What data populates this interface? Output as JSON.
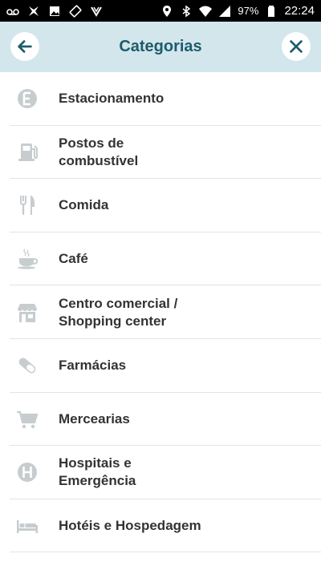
{
  "status_bar": {
    "battery": "97%",
    "time": "22:24"
  },
  "header": {
    "title": "Categorias",
    "back_icon": "arrow-left-icon",
    "close_icon": "close-icon",
    "accent": "#1e5c6b",
    "background": "#d2e6ec"
  },
  "categories": [
    {
      "label": "Estacionamento",
      "icon": "parking-icon"
    },
    {
      "label": "Postos de\ncombustível",
      "icon": "fuel-icon"
    },
    {
      "label": "Comida",
      "icon": "fork-knife-icon"
    },
    {
      "label": "Café",
      "icon": "coffee-cup-icon"
    },
    {
      "label": "Centro comercial /\nShopping center",
      "icon": "storefront-icon"
    },
    {
      "label": "Farmácias",
      "icon": "pill-icon"
    },
    {
      "label": "Mercearias",
      "icon": "cart-icon"
    },
    {
      "label": "Hospitais e\nEmergência",
      "icon": "hospital-icon"
    },
    {
      "label": "Hotéis e Hospedagem",
      "icon": "bed-icon"
    }
  ]
}
